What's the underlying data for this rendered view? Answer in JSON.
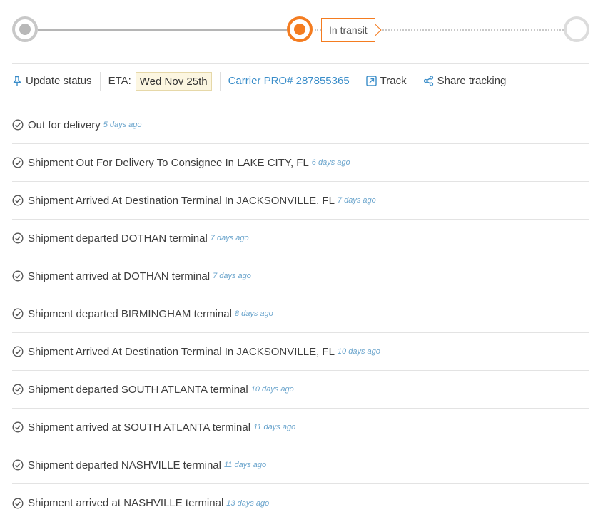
{
  "progress": {
    "current_status": "In transit"
  },
  "toolbar": {
    "update_status": "Update status",
    "eta_label": "ETA:",
    "eta_value": "Wed Nov 25th",
    "carrier_pro": "Carrier PRO# 287855365",
    "track": "Track",
    "share_tracking": "Share tracking"
  },
  "events": [
    {
      "text": "Out for delivery",
      "ago": "5 days ago"
    },
    {
      "text": "Shipment Out For Delivery To Consignee In LAKE CITY, FL",
      "ago": "6 days ago"
    },
    {
      "text": "Shipment Arrived At Destination Terminal In JACKSONVILLE, FL",
      "ago": "7 days ago"
    },
    {
      "text": "Shipment departed DOTHAN terminal",
      "ago": "7 days ago"
    },
    {
      "text": "Shipment arrived at DOTHAN terminal",
      "ago": "7 days ago"
    },
    {
      "text": "Shipment departed BIRMINGHAM terminal",
      "ago": "8 days ago"
    },
    {
      "text": "Shipment Arrived At Destination Terminal In JACKSONVILLE, FL",
      "ago": "10 days ago"
    },
    {
      "text": "Shipment departed SOUTH ATLANTA terminal",
      "ago": "10 days ago"
    },
    {
      "text": "Shipment arrived at SOUTH ATLANTA terminal",
      "ago": "11 days ago"
    },
    {
      "text": "Shipment departed NASHVILLE terminal",
      "ago": "11 days ago"
    },
    {
      "text": "Shipment arrived at NASHVILLE terminal",
      "ago": "13 days ago"
    }
  ],
  "colors": {
    "accent": "#f47c20",
    "link": "#3a8dc9",
    "eta_bg": "#fcf6e1"
  }
}
